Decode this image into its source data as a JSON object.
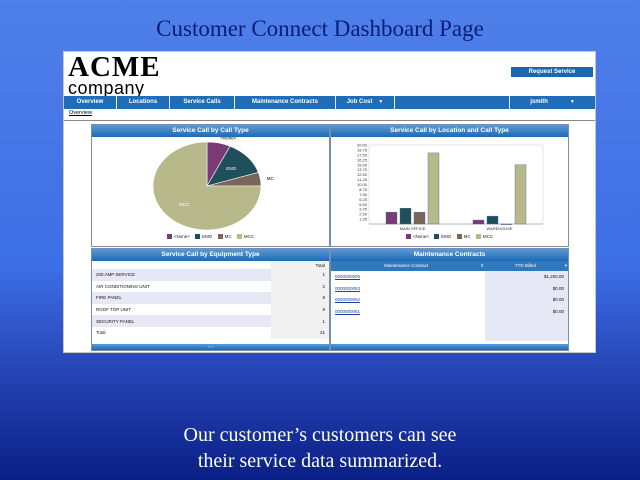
{
  "slide": {
    "title": "Customer Connect Dashboard Page",
    "caption_line1": "Our customer’s customers can see",
    "caption_line2": "their service data summarized."
  },
  "header": {
    "logo_line1": "ACME",
    "logo_line2": "company",
    "request_service": "Request Service"
  },
  "nav": {
    "items": [
      "Overview",
      "Locations",
      "Service Calls",
      "Maintenance Contracts",
      "Job Cost"
    ],
    "user": "jsmith",
    "breadcrumb": "Overview"
  },
  "colors": {
    "none": "#7a3a75",
    "emg": "#1f4f5a",
    "mc": "#7b6558",
    "mcc": "#b8b98b",
    "nav": "#1f6cb8",
    "accent": "#1c65b1"
  },
  "panels": {
    "pie_title": "Service Call by Call Type",
    "bar_title": "Service Call by Location and Call Type",
    "equipment_title": "Service Call by Equipment Type",
    "contracts_title": "Maintenance Contracts"
  },
  "legend": [
    "<None>",
    "EMG",
    "MC",
    "MCC"
  ],
  "chart_data": [
    {
      "type": "pie",
      "title": "Service Call by Call Type",
      "labels": [
        "<None>",
        "EMG",
        "MC",
        "MCC"
      ],
      "values": [
        7,
        13,
        5,
        75
      ]
    },
    {
      "type": "bar",
      "title": "Service Call by Location and Call Type",
      "categories": [
        "MAIN OFFICE",
        "WAREHOUSE"
      ],
      "series": [
        {
          "name": "<None>",
          "values": [
            3,
            1
          ]
        },
        {
          "name": "EMG",
          "values": [
            4,
            2
          ]
        },
        {
          "name": "MC",
          "values": [
            3,
            0
          ]
        },
        {
          "name": "MCC",
          "values": [
            18,
            15
          ]
        }
      ],
      "ylim": [
        0,
        20
      ],
      "yticks": [
        "20.00",
        "18.75",
        "17.50",
        "16.25",
        "15.00",
        "13.75",
        "12.50",
        "11.25",
        "10.00",
        "8.75",
        "7.50",
        "6.25",
        "5.00",
        "3.75",
        "2.50",
        "1.25"
      ]
    }
  ],
  "equipment": {
    "total_header": "Total",
    "rows": [
      {
        "name": "200 AMP SERVICE",
        "total": "1"
      },
      {
        "name": "AIR CONDITIONING UNIT",
        "total": "2"
      },
      {
        "name": "FIRE PANEL",
        "total": "9"
      },
      {
        "name": "ROOF TOP UNIT",
        "total": "8"
      },
      {
        "name": "SECURITY PANEL",
        "total": "1"
      },
      {
        "name": "Total",
        "total": "21"
      }
    ]
  },
  "contracts": {
    "col1": "Maintenance Contract",
    "col2": "TTD Billed",
    "rows": [
      {
        "contract": "0000000005",
        "billed": "$1,200.00"
      },
      {
        "contract": "0000000053",
        "billed": "$0.00"
      },
      {
        "contract": "0000000052",
        "billed": "$0.00"
      },
      {
        "contract": "0000000061",
        "billed": "$0.00"
      }
    ]
  }
}
